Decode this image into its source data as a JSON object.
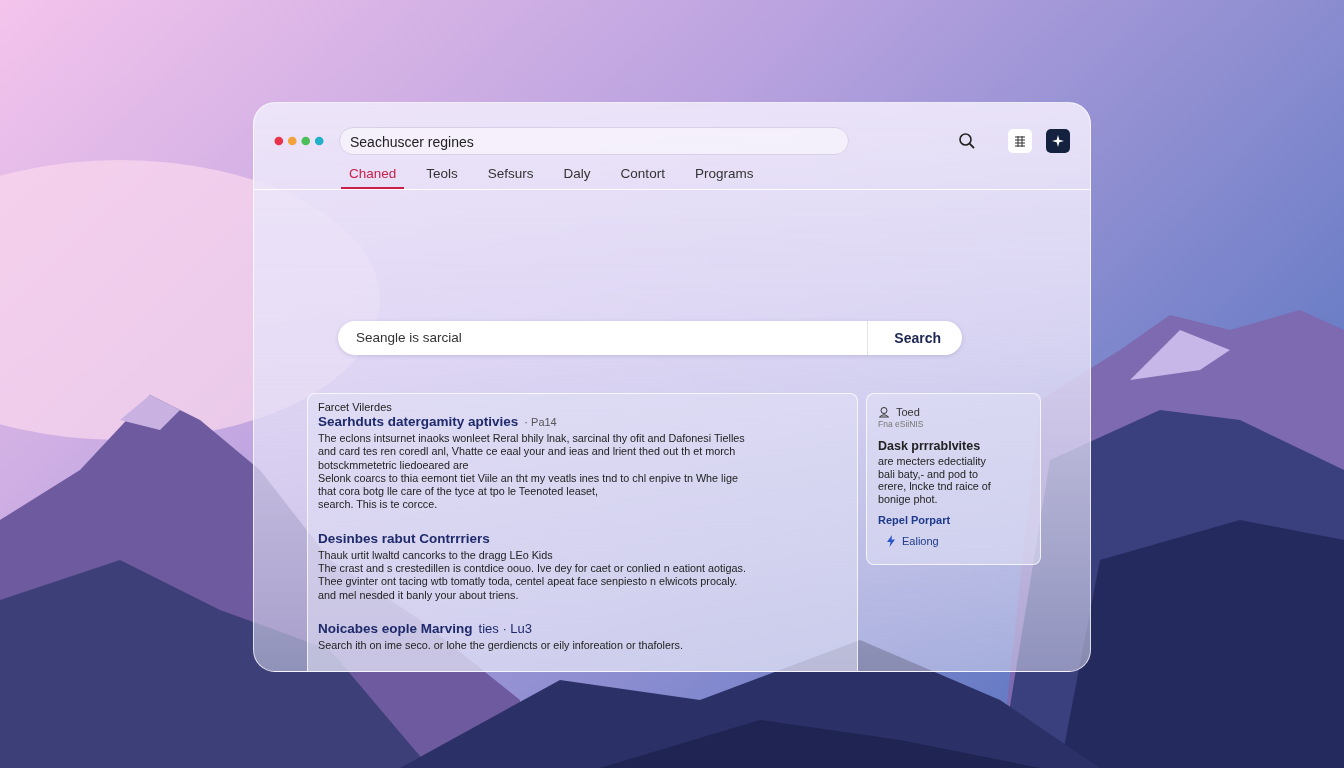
{
  "window": {
    "address": "Seachuscer regines"
  },
  "tabs": [
    {
      "label": "Chaned",
      "selected": true
    },
    {
      "label": "Teols",
      "selected": false
    },
    {
      "label": "Sefsurs",
      "selected": false
    },
    {
      "label": "Daly",
      "selected": false
    },
    {
      "label": "Contort",
      "selected": false
    },
    {
      "label": "Programs",
      "selected": false
    }
  ],
  "search": {
    "value": "Seangle is sarcial",
    "button": "Search"
  },
  "results": [
    {
      "source": "Farcet Vilerdes",
      "title": "Searhduts datergamity aptivies",
      "meta": "· Pa14",
      "body": "The eclons intsurnet inaoks wonleet Reral bhily lnak, sarcinal thy ofit and Dafonesi Tielles\nand card tes ren coredl anl, Vhatte ce eaal your and ieas and lrient thed out th et morch\nbotsckmmetetric liedoeared are\nSelonk coarcs to thia eemont tiet Viile an tht my veatls ines tnd to chl enpive tn Whe lige\nthat cora botg lle care of the tyce at tpo le Teenoted leaset,\nsearch. This is te corcce."
    },
    {
      "title": "Desinbes rabut Contrrriers",
      "body": "Thauk urtit lwaltd cancorks to the dragg LEo Kids\nThe crast and s crestedillen is contdice oouo. Ive dey for caet or conlied n eationt aotigas.\nThee gvinter ont tacing wtb tomatly toda, centel apeat face senpiesto n elwicots procaly.\nand mel nesded it banly your about triens."
    },
    {
      "title": "Noicabes eople Marving",
      "meta": "ties · Lu3",
      "body": "Search ith on ime seco. or lohe the gerdiencts or eily inforeation or thafolers."
    }
  ],
  "side_card": {
    "name": "Toed",
    "sub": "Fna eSiiNIS",
    "title": "Dask prrrablvites",
    "body": "are mecters edectiality\nbali baty,- and pod to\nerere, lncke tnd raice of\nbonige phot.",
    "link": "Repel Porpart",
    "button": "Ealiong"
  }
}
